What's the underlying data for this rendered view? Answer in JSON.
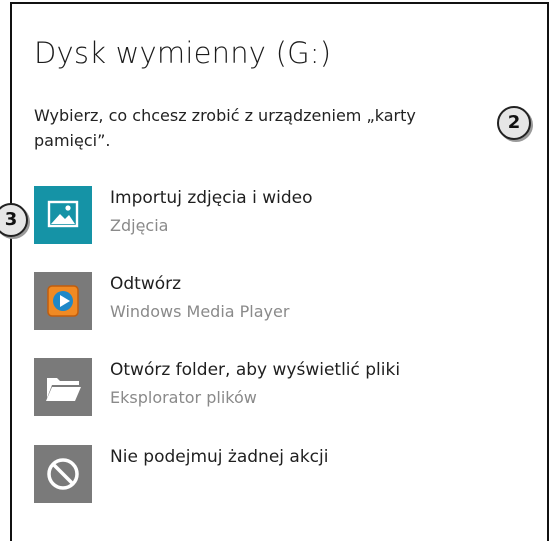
{
  "dialog": {
    "title": "Dysk wymienny (G:)",
    "prompt": "Wybierz, co chcesz zrobić z urządzeniem „karty pamięci”."
  },
  "options": [
    {
      "label": "Importuj zdjęcia i wideo",
      "sub": "Zdjęcia",
      "icon": "photo-import-icon",
      "tile_color": "#1593a6"
    },
    {
      "label": "Odtwórz",
      "sub": "Windows Media Player",
      "icon": "media-player-icon",
      "tile_color": "#7a7a7a"
    },
    {
      "label": "Otwórz folder, aby wyświetlić pliki",
      "sub": "Eksplorator plików",
      "icon": "folder-open-icon",
      "tile_color": "#7a7a7a"
    },
    {
      "label": "Nie podejmuj żadnej akcji",
      "sub": "",
      "icon": "no-action-icon",
      "tile_color": "#7a7a7a"
    }
  ],
  "callouts": {
    "c2": "2",
    "c3": "3"
  }
}
